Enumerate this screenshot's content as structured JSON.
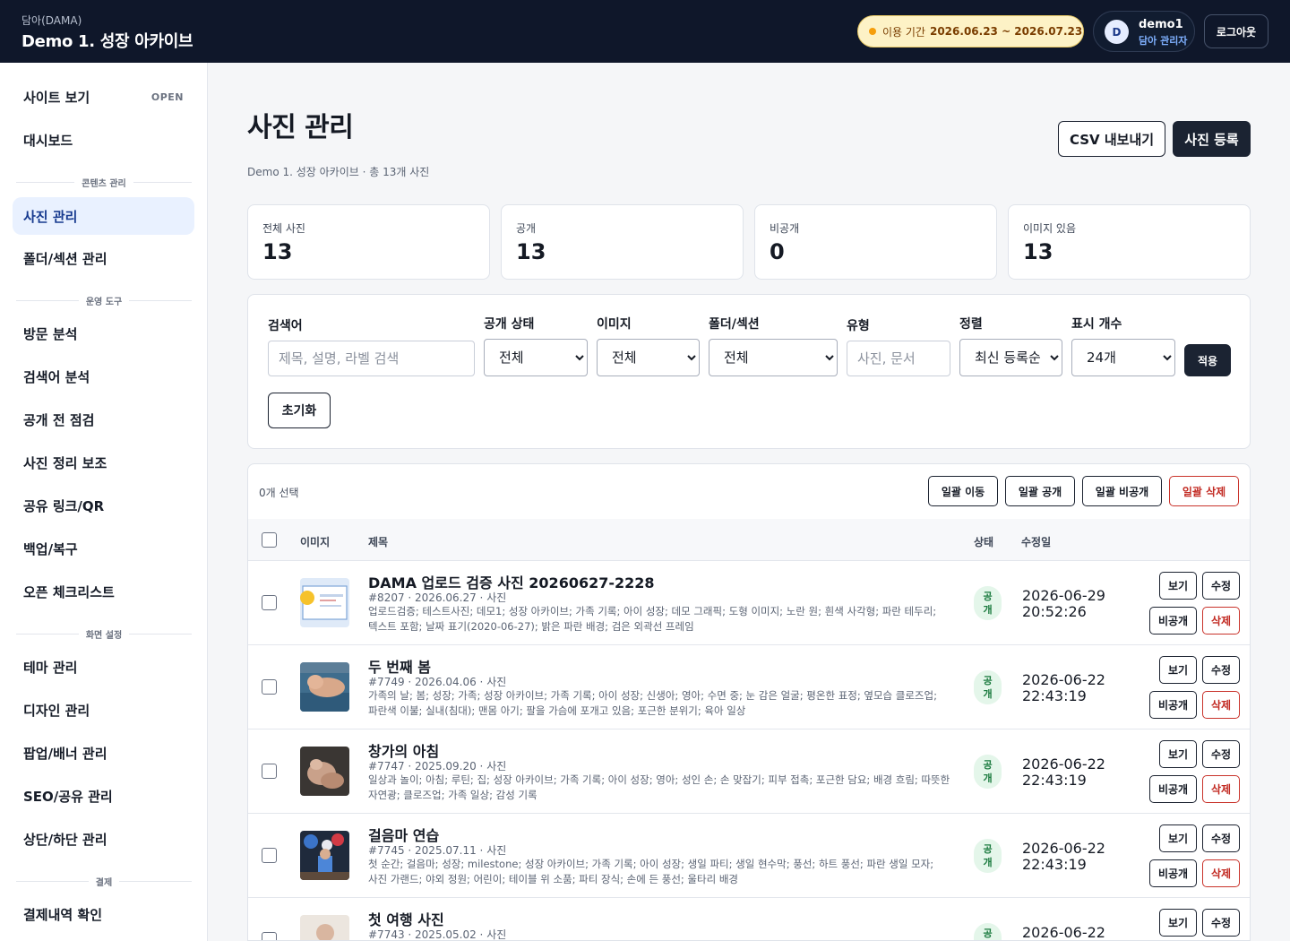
{
  "header": {
    "brand_sub": "담아(DAMA)",
    "brand_title": "Demo 1. 성장 아카이브",
    "period_label": "이용 기간",
    "period_dates": "2026.06.23 ~ 2026.07.23",
    "avatar_initial": "D",
    "user_name": "demo1",
    "user_role": "담아 관리자",
    "logout": "로그아웃"
  },
  "sidebar": {
    "site_view": "사이트 보기",
    "site_badge": "OPEN",
    "dashboard": "대시보드",
    "sections": {
      "content": "콘텐츠 관리",
      "ops": "운영 도구",
      "display": "화면 설정",
      "payment": "결제"
    },
    "items": {
      "photos": "사진 관리",
      "folders": "폴더/섹션 관리",
      "visits": "방문 분석",
      "search_terms": "검색어 분석",
      "pre_check": "공개 전 점검",
      "photo_assist": "사진 정리 보조",
      "share": "공유 링크/QR",
      "backup": "백업/복구",
      "checklist": "오픈 체크리스트",
      "theme": "테마 관리",
      "design": "디자인 관리",
      "popup": "팝업/배너 관리",
      "seo": "SEO/공유 관리",
      "header_footer": "상단/하단 관리",
      "payments": "결제내역 확인"
    }
  },
  "page": {
    "title": "사진 관리",
    "subtitle": "Demo 1. 성장 아카이브 · 총 13개 사진",
    "csv_button": "CSV 내보내기",
    "add_button": "사진 등록"
  },
  "stats": [
    {
      "label": "전체 사진",
      "value": "13"
    },
    {
      "label": "공개",
      "value": "13"
    },
    {
      "label": "비공개",
      "value": "0"
    },
    {
      "label": "이미지 있음",
      "value": "13"
    }
  ],
  "filters": {
    "search_label": "검색어",
    "search_placeholder": "제목, 설명, 라벨 검색",
    "status_label": "공개 상태",
    "status_value": "전체",
    "image_label": "이미지",
    "image_value": "전체",
    "folder_label": "폴더/섹션",
    "folder_value": "전체",
    "type_label": "유형",
    "type_placeholder": "사진, 문서",
    "sort_label": "정렬",
    "sort_value": "최신 등록순",
    "count_label": "표시 개수",
    "count_value": "24개",
    "apply": "적용",
    "reset": "초기화"
  },
  "list": {
    "selected": "0개 선택",
    "bulk_move": "일괄 이동",
    "bulk_public": "일괄 공개",
    "bulk_private": "일괄 비공개",
    "bulk_delete": "일괄 삭제",
    "col_image": "이미지",
    "col_title": "제목",
    "col_status": "상태",
    "col_updated": "수정일",
    "action_view": "보기",
    "action_edit": "수정",
    "action_private": "비공개",
    "action_delete": "삭제",
    "rows": [
      {
        "title": "DAMA 업로드 검증 사진 20260627-2228",
        "meta": "#8207 · 2026.06.27 · 사진",
        "desc": "업로드검증; 테스트사진; 데모1; 성장 아카이브; 가족 기록; 아이 성장; 데모 그래픽; 도형 이미지; 노란 원; 흰색 사각형; 파란 테두리; 텍스트 포함; 날짜 표기(2020-06-27); 밝은 파란 배경; 검은 외곽선 프레임",
        "status": "공개",
        "date": "2026-06-29",
        "time": "20:52:26",
        "thumb": "graphic"
      },
      {
        "title": "두 번째 봄",
        "meta": "#7749 · 2026.04.06 · 사진",
        "desc": "가족의 날; 봄; 성장; 가족; 성장 아카이브; 가족 기록; 아이 성장; 신생아; 영아; 수면 중; 눈 감은 얼굴; 평온한 표정; 옆모습 클로즈업; 파란색 이불; 실내(침대); 맨몸 아기; 팔을 가슴에 포개고 있음; 포근한 분위기; 육아 일상",
        "status": "공개",
        "date": "2026-06-22",
        "time": "22:43:19",
        "thumb": "baby"
      },
      {
        "title": "창가의 아침",
        "meta": "#7747 · 2025.09.20 · 사진",
        "desc": "일상과 놀이; 아침; 루틴; 집; 성장 아카이브; 가족 기록; 아이 성장; 영아; 성인 손; 손 맞잡기; 피부 접촉; 포근한 담요; 배경 흐림; 따뜻한 자연광; 클로즈업; 가족 일상; 감성 기록",
        "status": "공개",
        "date": "2026-06-22",
        "time": "22:43:19",
        "thumb": "hands"
      },
      {
        "title": "걸음마 연습",
        "meta": "#7745 · 2025.07.11 · 사진",
        "desc": "첫 순간; 걸음마; 성장; milestone; 성장 아카이브; 가족 기록; 아이 성장; 생일 파티; 생일 현수막; 풍선; 하트 풍선; 파란 생일 모자; 사진 가랜드; 야외 정원; 어린이; 테이블 위 소품; 파티 장식; 손에 든 풍선; 울타리 배경",
        "status": "공개",
        "date": "2026-06-22",
        "time": "22:43:19",
        "thumb": "party"
      },
      {
        "title": "첫 여행 사진",
        "meta": "#7743 · 2025.05.02 · 사진",
        "desc": "",
        "status": "공개",
        "date": "2026-06-22",
        "time": "",
        "thumb": "travel"
      }
    ]
  },
  "colors": {
    "topbar": "#0f172a",
    "accent": "#173a8f",
    "active_nav": "#e9f1ff",
    "public_badge": "#e4f6ea",
    "danger": "#c22a22"
  }
}
